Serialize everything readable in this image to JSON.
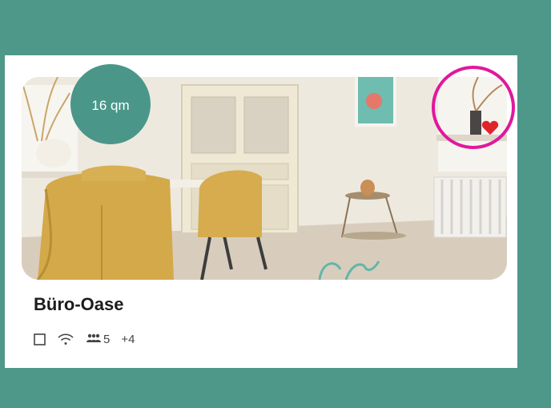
{
  "listing": {
    "size_badge": "16 qm",
    "title": "Büro-Oase",
    "favorite": true,
    "amenities": {
      "icons": [
        "desk-icon",
        "wifi-icon",
        "people-icon"
      ],
      "capacity": "5",
      "more": "+4"
    }
  },
  "colors": {
    "background": "#4e988a",
    "badge": "#4a978a",
    "heart": "#e0242c",
    "highlight": "#e0189c"
  }
}
